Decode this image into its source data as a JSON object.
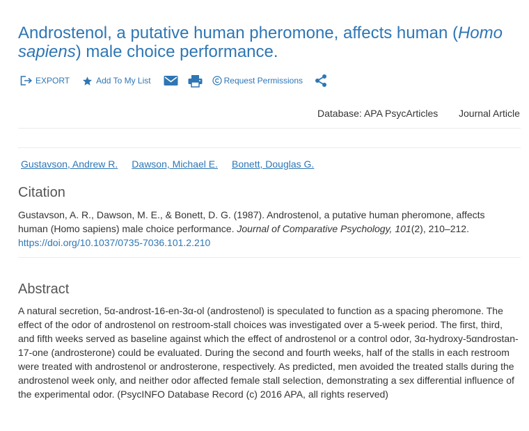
{
  "article": {
    "title_part1": "Androstenol, a putative human pheromone, affects human (",
    "title_italic": "Homo sapiens",
    "title_part2": ") male choice performance."
  },
  "toolbar": {
    "export_label": "EXPORT",
    "add_to_list_label": "Add To My List",
    "request_permissions_label": "Request Permissions",
    "icons": [
      "export-icon",
      "star-icon",
      "email-icon",
      "print-icon",
      "copyright-icon",
      "share-icon"
    ]
  },
  "meta": {
    "database": "Database: APA PsycArticles",
    "doc_type": "Journal Article"
  },
  "authors": [
    "Gustavson, Andrew R.",
    "Dawson, Michael E.",
    "Bonett, Douglas G."
  ],
  "citation": {
    "heading": "Citation",
    "text_before": "Gustavson, A. R., Dawson, M. E., & Bonett, D. G. (1987). Androstenol, a putative human pheromone, affects human (Homo sapiens) male choice performance. ",
    "journal": "Journal of Comparative Psychology, 101",
    "text_after": "(2), 210–212.",
    "doi": "https://doi.org/10.1037/0735-7036.101.2.210"
  },
  "abstract": {
    "heading": "Abstract",
    "text": "A natural secretion, 5α-androst-16-en-3α-ol (androstenol) is speculated to function as a spacing pheromone. The effect of the odor of androstenol on restroom-stall choices was investigated over a 5-week period. The first, third, and fifth weeks served as baseline against which the effect of androstenol or a control odor, 3α-hydroxy-5αndrostan-17-one (androsterone) could be evaluated. During the second and fourth weeks, half of the stalls in each restroom were treated with androstenol or androsterone, respectively. As predicted, men avoided the treated stalls during the androstenol week only, and neither odor affected female stall selection, demonstrating a sex differential influence of the experimental odor. (PsycINFO Database Record (c) 2016 APA, all rights reserved)"
  },
  "colors": {
    "link": "#2e76b4",
    "text": "#333333",
    "heading": "#555555",
    "divider": "#ececec"
  }
}
